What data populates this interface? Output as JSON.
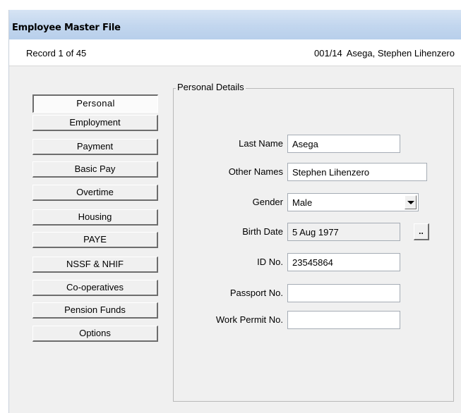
{
  "window": {
    "title": "Employee Master File"
  },
  "record": {
    "count_text": "Record 1 of 45",
    "employee_code": "001/14",
    "employee_name": "Asega, Stephen Lihenzero"
  },
  "nav": {
    "items": [
      {
        "label": "Personal",
        "active": true
      },
      {
        "label": "Employment",
        "active": false
      },
      {
        "label": "Payment",
        "active": false
      },
      {
        "label": "Basic Pay",
        "active": false
      },
      {
        "label": "Overtime",
        "active": false
      },
      {
        "label": "Housing",
        "active": false
      },
      {
        "label": "PAYE",
        "active": false
      },
      {
        "label": "NSSF & NHIF",
        "active": false
      },
      {
        "label": "Co-operatives",
        "active": false
      },
      {
        "label": "Pension Funds",
        "active": false
      },
      {
        "label": "Options",
        "active": false
      }
    ]
  },
  "personal_details": {
    "group_title": "Personal Details",
    "last_name": {
      "label": "Last Name",
      "value": "Asega"
    },
    "other_names": {
      "label": "Other Names",
      "value": "Stephen Lihenzero"
    },
    "gender": {
      "label": "Gender",
      "value": "Male"
    },
    "birth_date": {
      "label": "Birth Date",
      "value": "5 Aug 1977",
      "picker_label": ".."
    },
    "id_no": {
      "label": "ID No.",
      "value": "23545864"
    },
    "passport_no": {
      "label": "Passport No.",
      "value": ""
    },
    "work_permit_no": {
      "label": "Work Permit No.",
      "value": ""
    }
  }
}
